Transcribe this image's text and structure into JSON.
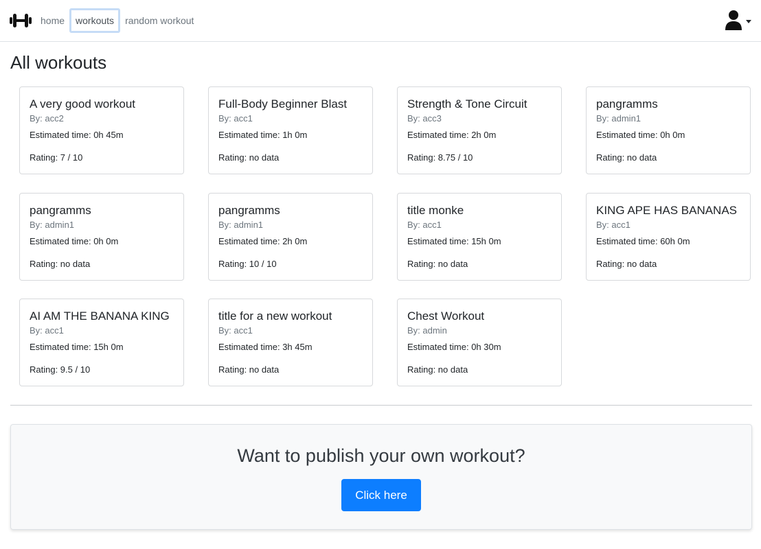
{
  "nav": {
    "links": [
      {
        "label": "home"
      },
      {
        "label": "workouts"
      },
      {
        "label": "random workout"
      }
    ]
  },
  "page": {
    "title": "All workouts"
  },
  "workouts": [
    {
      "title": "A very good workout",
      "author": "By: acc2",
      "time": "Estimated time: 0h 45m",
      "rating": "Rating: 7 / 10"
    },
    {
      "title": "Full-Body Beginner Blast",
      "author": "By: acc1",
      "time": "Estimated time: 1h 0m",
      "rating": "Rating: no data"
    },
    {
      "title": "Strength & Tone Circuit",
      "author": "By: acc3",
      "time": "Estimated time: 2h 0m",
      "rating": "Rating: 8.75 / 10"
    },
    {
      "title": "pangramms",
      "author": "By: admin1",
      "time": "Estimated time: 0h 0m",
      "rating": "Rating: no data"
    },
    {
      "title": "pangramms",
      "author": "By: admin1",
      "time": "Estimated time: 0h 0m",
      "rating": "Rating: no data"
    },
    {
      "title": "pangramms",
      "author": "By: admin1",
      "time": "Estimated time: 2h 0m",
      "rating": "Rating: 10 / 10"
    },
    {
      "title": "title monke",
      "author": "By: acc1",
      "time": "Estimated time: 15h 0m",
      "rating": "Rating: no data"
    },
    {
      "title": "KING APE HAS BANANAS",
      "author": "By: acc1",
      "time": "Estimated time: 60h 0m",
      "rating": "Rating: no data"
    },
    {
      "title": "AI AM THE BANANA KING",
      "author": "By: acc1",
      "time": "Estimated time: 15h 0m",
      "rating": "Rating: 9.5 / 10"
    },
    {
      "title": "title for a new workout",
      "author": "By: acc1",
      "time": "Estimated time: 3h 45m",
      "rating": "Rating: no data"
    },
    {
      "title": "Chest Workout",
      "author": "By: admin",
      "time": "Estimated time: 0h 30m",
      "rating": "Rating: no data"
    }
  ],
  "cta": {
    "heading": "Want to publish your own workout?",
    "button_label": "Click here"
  },
  "icons": {
    "brand": "dumbbell-icon",
    "user": "user-icon"
  },
  "colors": {
    "primary": "#0d7eff",
    "active_outline": "#c6dcf6"
  }
}
